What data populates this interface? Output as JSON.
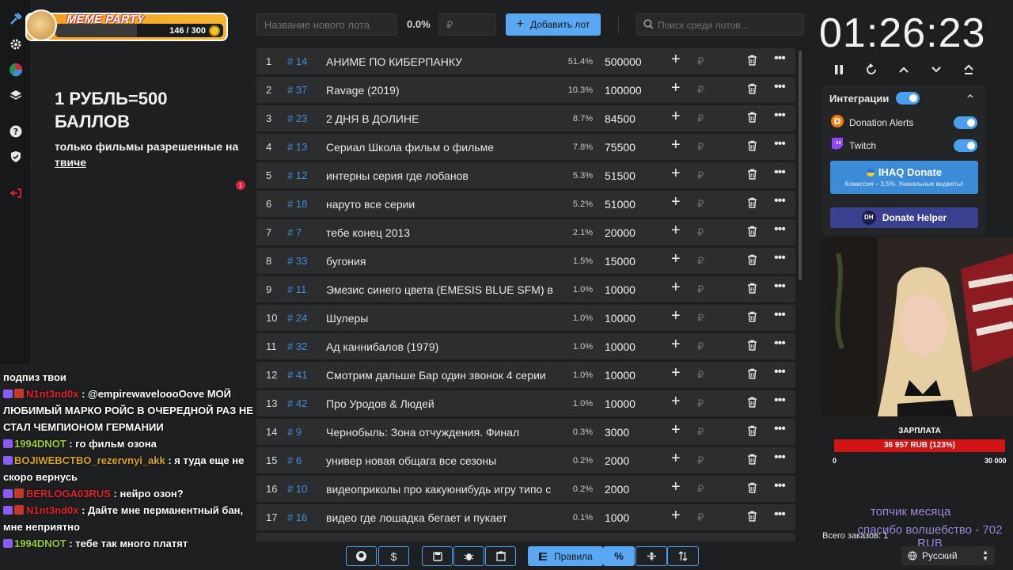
{
  "meme": {
    "title": "MEME PARTY",
    "count": "146 / 300",
    "progress": 0.487
  },
  "promo": {
    "title": "1 РУБЛЬ=500 БАЛЛОВ",
    "sub_prefix": "только фильмы разрешенные на ",
    "sub_link": "твиче"
  },
  "notif_count": "1",
  "chat": [
    {
      "user": "",
      "text": "подпиз твои",
      "color": "#ffffff"
    },
    {
      "user": "N1nt3nd0x",
      "text": " : @empirewaveloooOove МОЙ ЛЮБИМЫЙ МАРКО РОЙС В ОЧЕРЕДНОЙ РАЗ НЕ СТАЛ ЧЕМПИОНОМ ГЕРМАНИИ",
      "color": "#e0232d"
    },
    {
      "user": "1994DNOT",
      "text": " : го фильм озона",
      "color": "#9acd32"
    },
    {
      "user": "BOJIWEBCTBO_rezervnyi_akk",
      "text": " : я туда еще не скоро вернусь",
      "color": "#daa520"
    },
    {
      "user": "BERLOGA03RUS",
      "text": " : нейро озон?",
      "color": "#e0232d"
    },
    {
      "user": "N1nt3nd0x",
      "text": " : Дайте мне перманентный бан, мне неприятно",
      "color": "#e0232d"
    },
    {
      "user": "1994DNOT",
      "text": " : тебе так много платят",
      "color": "#9acd32"
    }
  ],
  "topbar": {
    "lot_placeholder": "Название нового лота",
    "percent": "0.0%",
    "rub_placeholder": "₽",
    "add_label": "Добавить лот",
    "search_placeholder": "Поиск среди лотов..."
  },
  "lots": [
    {
      "n": "1",
      "id": "# 14",
      "name": "АНИМЕ ПО КИБЕРПАНКУ",
      "pct": "51.4%",
      "amount": "500000"
    },
    {
      "n": "2",
      "id": "# 37",
      "name": "Ravage (2019)",
      "pct": "10.3%",
      "amount": "100000"
    },
    {
      "n": "3",
      "id": "# 23",
      "name": "2 ДНЯ В ДОЛИНЕ",
      "pct": "8.7%",
      "amount": "84500"
    },
    {
      "n": "4",
      "id": "# 13",
      "name": "Сериал Школа фильм о фильме",
      "pct": "7.8%",
      "amount": "75500"
    },
    {
      "n": "5",
      "id": "# 12",
      "name": "интерны серия где лобанов",
      "pct": "5.3%",
      "amount": "51500"
    },
    {
      "n": "6",
      "id": "# 18",
      "name": "наруто все серии",
      "pct": "5.2%",
      "amount": "51000"
    },
    {
      "n": "7",
      "id": "# 7",
      "name": "тебе конец 2013",
      "pct": "2.1%",
      "amount": "20000"
    },
    {
      "n": "8",
      "id": "# 33",
      "name": "бугония",
      "pct": "1.5%",
      "amount": "15000"
    },
    {
      "n": "9",
      "id": "# 11",
      "name": "Эмезис синего цвета (EMESIS BLUE SFM) в р",
      "pct": "1.0%",
      "amount": "10000"
    },
    {
      "n": "10",
      "id": "# 24",
      "name": "Шулеры",
      "pct": "1.0%",
      "amount": "10000"
    },
    {
      "n": "11",
      "id": "# 32",
      "name": "Ад каннибалов (1979)",
      "pct": "1.0%",
      "amount": "10000"
    },
    {
      "n": "12",
      "id": "# 41",
      "name": "Смотрим дальше Бар один звонок 4 серии",
      "pct": "1.0%",
      "amount": "10000"
    },
    {
      "n": "13",
      "id": "# 42",
      "name": "Про Уродов & Людей",
      "pct": "1.0%",
      "amount": "10000"
    },
    {
      "n": "14",
      "id": "# 9",
      "name": "Чернобыль: Зона отчуждения. Финал",
      "pct": "0.3%",
      "amount": "3000"
    },
    {
      "n": "15",
      "id": "# 6",
      "name": "универ новая общага все сезоны",
      "pct": "0.2%",
      "amount": "2000"
    },
    {
      "n": "16",
      "id": "# 10",
      "name": "видеоприколы про какуюнибудь игру типо с",
      "pct": "0.2%",
      "amount": "2000"
    },
    {
      "n": "17",
      "id": "# 16",
      "name": "видео где лошадка бегает и пукает",
      "pct": "0.1%",
      "amount": "1000"
    }
  ],
  "toolbar": {
    "rules_label": "Правила",
    "percent_label": "%"
  },
  "timer": "01:26:23",
  "integrations": {
    "title": "Интеграции",
    "items": [
      {
        "name": "Donation Alerts"
      },
      {
        "name": "Twitch"
      }
    ],
    "iq_title": "IHAQ Donate",
    "iq_sub": "Комиссия – 3,5%. Уникальные виджеты!",
    "dh_label": "Donate Helper"
  },
  "salary": {
    "label": "ЗАРПЛАТА",
    "value": "36 957 RUB (123%)",
    "min": "0",
    "max": "30 000"
  },
  "overlay": {
    "top_month": "топчик месяца",
    "spell": "спасибо волшебство - 702 RUB"
  },
  "total_orders": "Всего заказов: 1",
  "language": "Русский",
  "colors": {
    "accent": "#5aa7f2",
    "row_bg": "#2b2d2f",
    "id_blue": "#3e8ed8",
    "salary_red": "#d11414"
  }
}
